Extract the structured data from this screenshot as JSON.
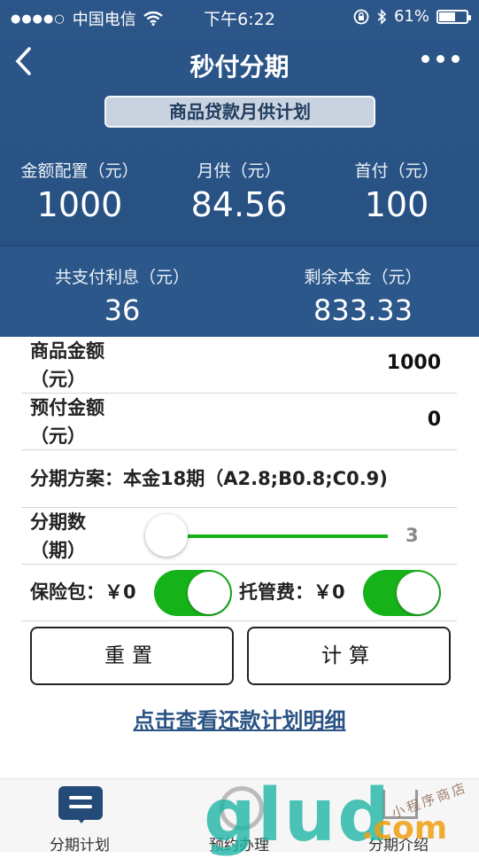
{
  "status_bar": {
    "carrier": "中国电信",
    "time": "下午6:22",
    "battery": "61%",
    "battery_level": 0.61
  },
  "nav": {
    "title": "秒付分期"
  },
  "plan_label": "商品贷款月供计划",
  "summary": {
    "amount": {
      "label": "金额配置（元）",
      "value": "1000"
    },
    "monthly": {
      "label": "月供（元）",
      "value": "84.56"
    },
    "down": {
      "label": "首付（元）",
      "value": "100"
    },
    "interest": {
      "label": "共支付利息（元）",
      "value": "36"
    },
    "remaining": {
      "label": "剩余本金（元）",
      "value": "833.33"
    }
  },
  "form": {
    "goods_amount": {
      "label_line1": "商品金额",
      "label_line2": "（元）",
      "value": "1000"
    },
    "prepay_amount": {
      "label_line1": "预付金额",
      "label_line2": "（元）",
      "value": "0"
    },
    "scheme": "分期方案：本金18期（A2.8;B0.8;C0.9)",
    "periods": {
      "label_line1": "分期数",
      "label_line2": "（期）",
      "value": "3"
    },
    "insurance": {
      "label": "保险包：￥0",
      "on": true
    },
    "custody": {
      "label": "托管费：￥0",
      "on": true
    }
  },
  "buttons": {
    "reset": "重置",
    "calc": "计算"
  },
  "detail_link": "点击查看还款计划明细",
  "tabs": [
    {
      "label": "分期计划"
    },
    {
      "label": "预约办理"
    },
    {
      "label": "分期介绍"
    }
  ],
  "watermark": {
    "logo": "glud",
    "suffix": ".com",
    "stamp": "小程序商店"
  },
  "colors": {
    "header": "#2c5689",
    "toggle_on": "#16b21a",
    "link": "#2b5384"
  }
}
